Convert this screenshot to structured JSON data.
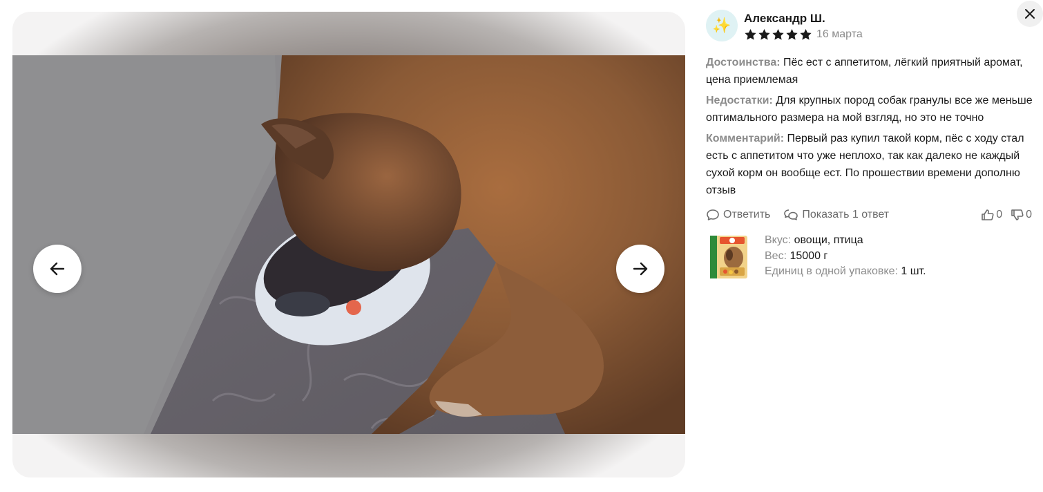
{
  "gallery": {
    "photo_alt": "",
    "prev_icon": "arrow-left-icon",
    "next_icon": "arrow-right-icon"
  },
  "close_icon": "close-icon",
  "review": {
    "avatar_icon": "sparkles-icon",
    "avatar_glyph": "✨",
    "author": "Александр Ш.",
    "rating": 5,
    "rating_max": 5,
    "date": "16 марта",
    "pros_label": "Достоинства:",
    "pros_text": "Пёс ест с аппетитом, лёгкий приятный аромат, цена приемлемая",
    "cons_label": "Недостатки:",
    "cons_text": "Для крупных пород собак гранулы все же меньше оптимального размера на мой взгляд, но это не точно",
    "comment_label": "Комментарий:",
    "comment_text": "Первый раз купил такой корм, пёс с ходу стал есть с аппетитом что уже неплохо, так как далеко не каждый сухой корм он вообще ест. По прошествии времени дополню отзыв"
  },
  "actions": {
    "reply_label": "Ответить",
    "show_replies_label": "Показать 1 ответ",
    "likes": "0",
    "dislikes": "0"
  },
  "product": {
    "taste_label": "Вкус:",
    "taste_value": "овощи, птица",
    "weight_label": "Вес:",
    "weight_value": "15000 г",
    "units_label": "Единиц в одной упаковке:",
    "units_value": "1 шт."
  },
  "colors": {
    "star": "#1a1a1a",
    "muted_text": "#8b8b8b",
    "avatar_bg": "#dff2f4"
  }
}
